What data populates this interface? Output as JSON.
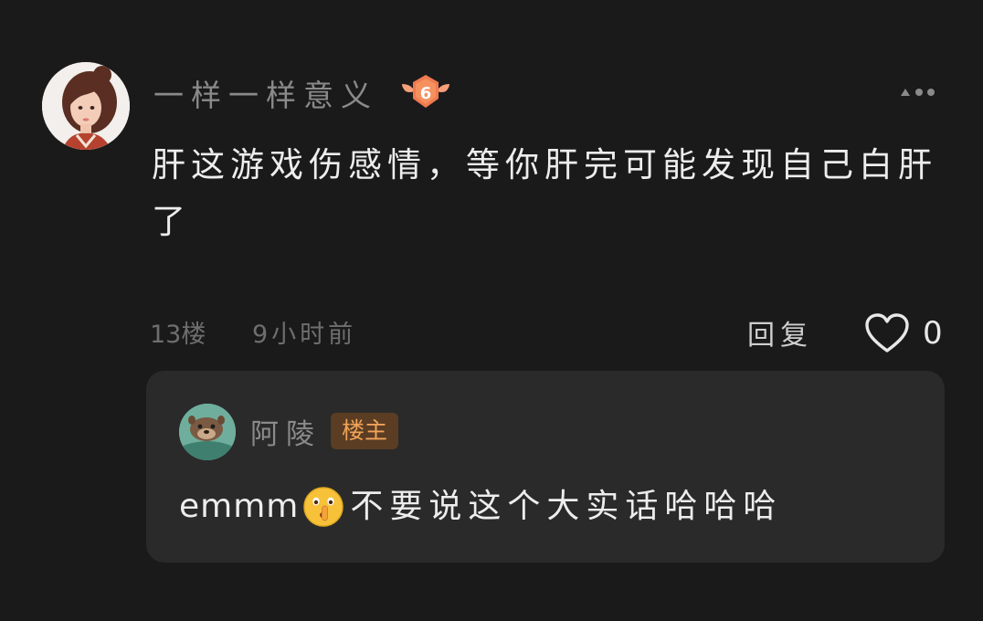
{
  "comment": {
    "username": "一样一样意义",
    "level": "6",
    "text": "肝这游戏伤感情，等你肝完可能发现自己白肝了",
    "floor": "13楼",
    "time": "9小时前",
    "reply_label": "回复",
    "like_count": "0"
  },
  "reply": {
    "author": "阿陵",
    "badge": "楼主",
    "text_before_emoji": "emmm",
    "emoji": "shushing-face-emoji",
    "text_after_emoji": "不要说这个大实话哈哈哈"
  },
  "colors": {
    "background": "#1a1a1a",
    "card": "#2a2a2a",
    "badge_orange": "#f0a35a",
    "level_badge": "#f07a52"
  }
}
